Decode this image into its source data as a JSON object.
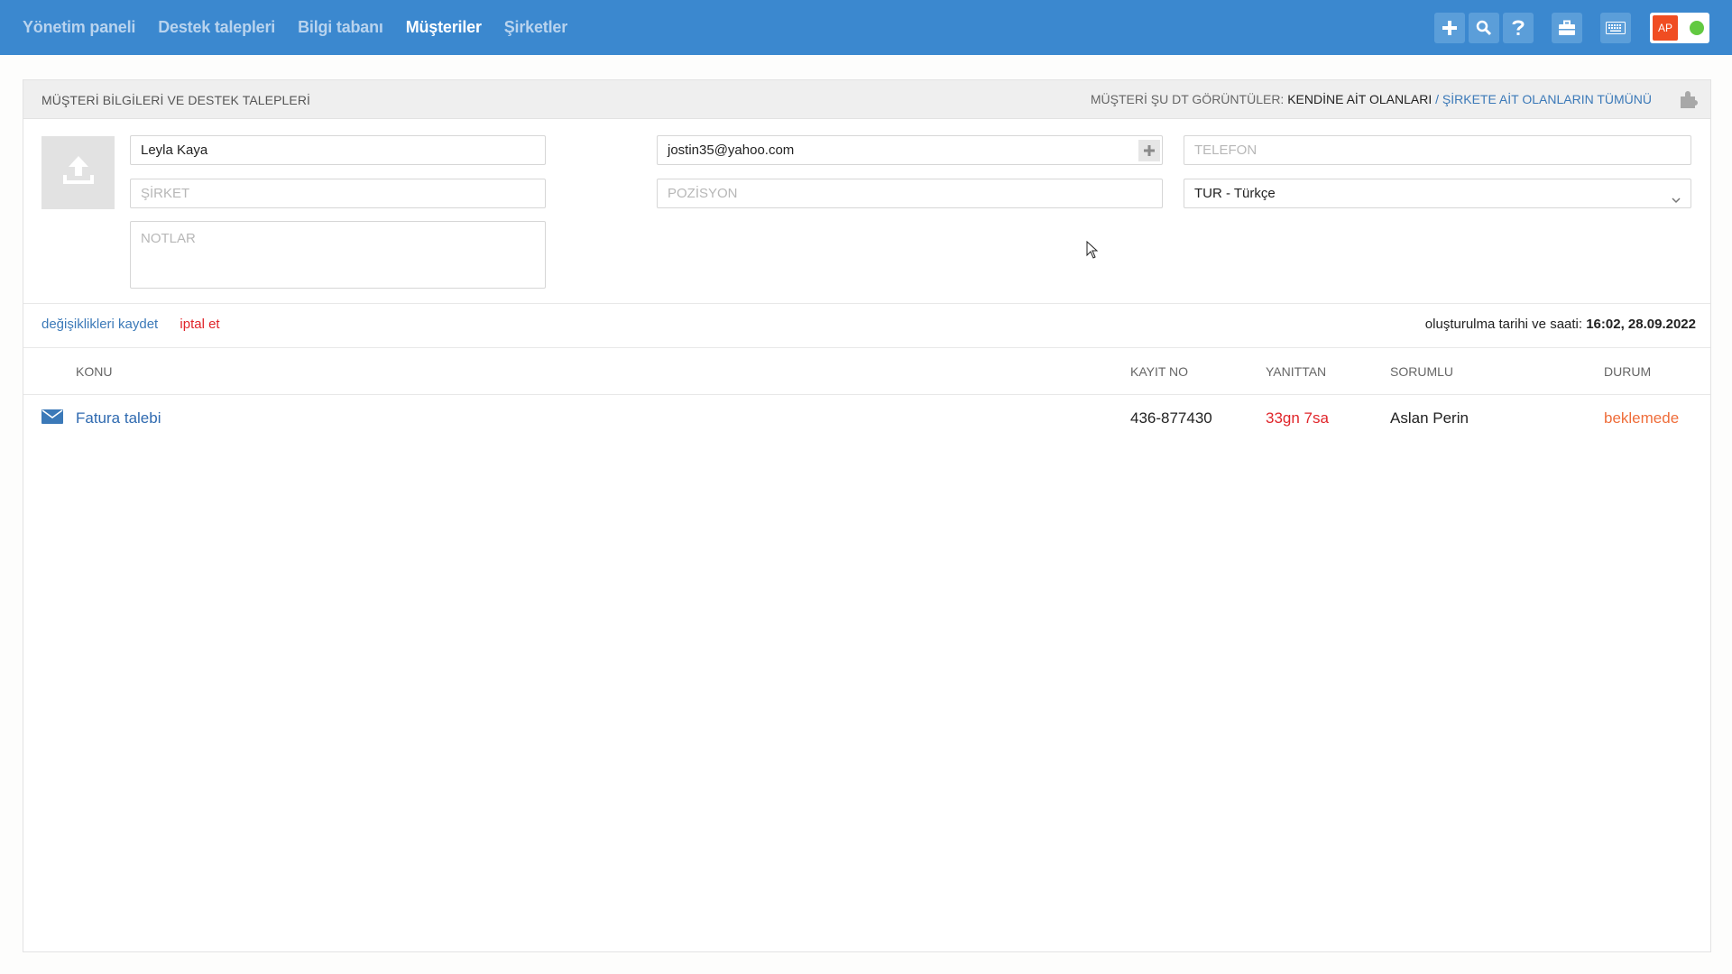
{
  "nav": {
    "items": [
      {
        "label": "Yönetim paneli",
        "active": false
      },
      {
        "label": "Destek talepleri",
        "active": false
      },
      {
        "label": "Bilgi tabanı",
        "active": false
      },
      {
        "label": "Müşteriler",
        "active": true
      },
      {
        "label": "Şirketler",
        "active": false
      }
    ]
  },
  "toolbar": {
    "icons": [
      "plus-icon",
      "search-icon",
      "help-icon",
      "briefcase-icon",
      "keyboard-icon"
    ],
    "user_initials": "AP",
    "status_color": "#62c941"
  },
  "panel": {
    "title": "MÜŞTERİ BİLGİLERİ VE DESTEK TALEPLERİ",
    "view_label": "MÜŞTERİ ŞU DT GÖRÜNTÜLER:",
    "view_current": "KENDİNE AİT OLANLARI",
    "view_separator": "/",
    "view_other": "ŞİRKETE AİT OLANLARIN TÜMÜNÜ"
  },
  "form": {
    "name": {
      "value": "Leyla Kaya",
      "placeholder": ""
    },
    "email": {
      "value": "jostin35@yahoo.com",
      "placeholder": ""
    },
    "phone": {
      "value": "",
      "placeholder": "TELEFON"
    },
    "company": {
      "value": "",
      "placeholder": "ŞİRKET"
    },
    "position": {
      "value": "",
      "placeholder": "POZİSYON"
    },
    "language": {
      "value": "TUR - Türkçe"
    },
    "notes": {
      "value": "",
      "placeholder": "NOTLAR"
    }
  },
  "actions": {
    "save_label": "değişiklikleri kaydet",
    "cancel_label": "iptal et",
    "created_label": "oluşturulma tarihi ve saati:",
    "created_value": "16:02, 28.09.2022"
  },
  "table": {
    "headers": {
      "subject": "KONU",
      "record_no": "KAYIT NO",
      "since": "YANITTAN",
      "owner": "SORUMLU",
      "status": "DURUM"
    },
    "rows": [
      {
        "subject": "Fatura talebi",
        "record_no": "436-877430",
        "since": "33gn 7sa",
        "owner": "Aslan Perin",
        "status": "beklemede"
      }
    ]
  },
  "colors": {
    "topbar": "#3b88cf",
    "link": "#3b79b8",
    "danger": "#e0252a",
    "pending": "#ef6d3a",
    "avatar": "#f04d22"
  }
}
